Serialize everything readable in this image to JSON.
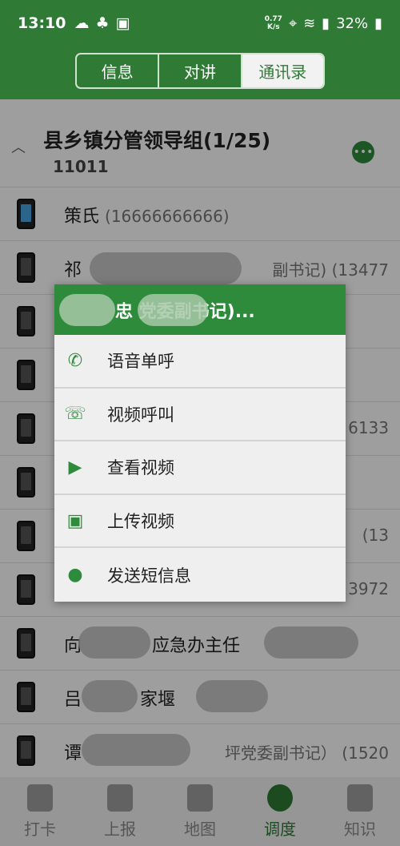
{
  "status": {
    "time": "13:10",
    "speed_top": "0.77",
    "speed_bottom": "K/s",
    "battery": "32%",
    "network": "4G"
  },
  "tabs": [
    "信息",
    "对讲",
    "通讯录"
  ],
  "group": {
    "title": "县乡镇分管领导组(1/25)",
    "code": "11011"
  },
  "contacts": [
    {
      "name": "策氏",
      "phone": "(16666666666)",
      "right": ""
    },
    {
      "name": "祁",
      "phone": "",
      "right": "副书记) (13477"
    },
    {
      "name": "",
      "phone": "",
      "right": ""
    },
    {
      "name": "",
      "phone": "",
      "right": ""
    },
    {
      "name": "",
      "phone": "",
      "right": "6133"
    },
    {
      "name": "",
      "phone": "",
      "right": ""
    },
    {
      "name": "",
      "phone": "",
      "right": "(13"
    },
    {
      "name": "",
      "phone": "",
      "right": "3972"
    },
    {
      "name": "向",
      "phone": "",
      "right": "应急办主任"
    },
    {
      "name": "吕",
      "phone": "",
      "right": "家堰"
    },
    {
      "name": "谭",
      "phone": "",
      "right": "坪党委副书记） (1520"
    }
  ],
  "dialog": {
    "title": "忠 党委副书记)...",
    "items": [
      {
        "label": "语音单呼",
        "icon": "phone-icon"
      },
      {
        "label": "视频呼叫",
        "icon": "video-call-icon"
      },
      {
        "label": "查看视频",
        "icon": "camera-icon"
      },
      {
        "label": "上传视频",
        "icon": "upload-video-icon"
      },
      {
        "label": "发送短信息",
        "icon": "chat-bubble-icon"
      }
    ]
  },
  "nav": [
    {
      "label": "打卡",
      "icon": "clipboard-icon"
    },
    {
      "label": "上报",
      "icon": "report-icon"
    },
    {
      "label": "地图",
      "icon": "map-icon"
    },
    {
      "label": "调度",
      "icon": "aperture-icon"
    },
    {
      "label": "知识",
      "icon": "books-icon"
    }
  ],
  "colors": {
    "primary": "#2f7a35",
    "accent": "#2f8b3c"
  }
}
